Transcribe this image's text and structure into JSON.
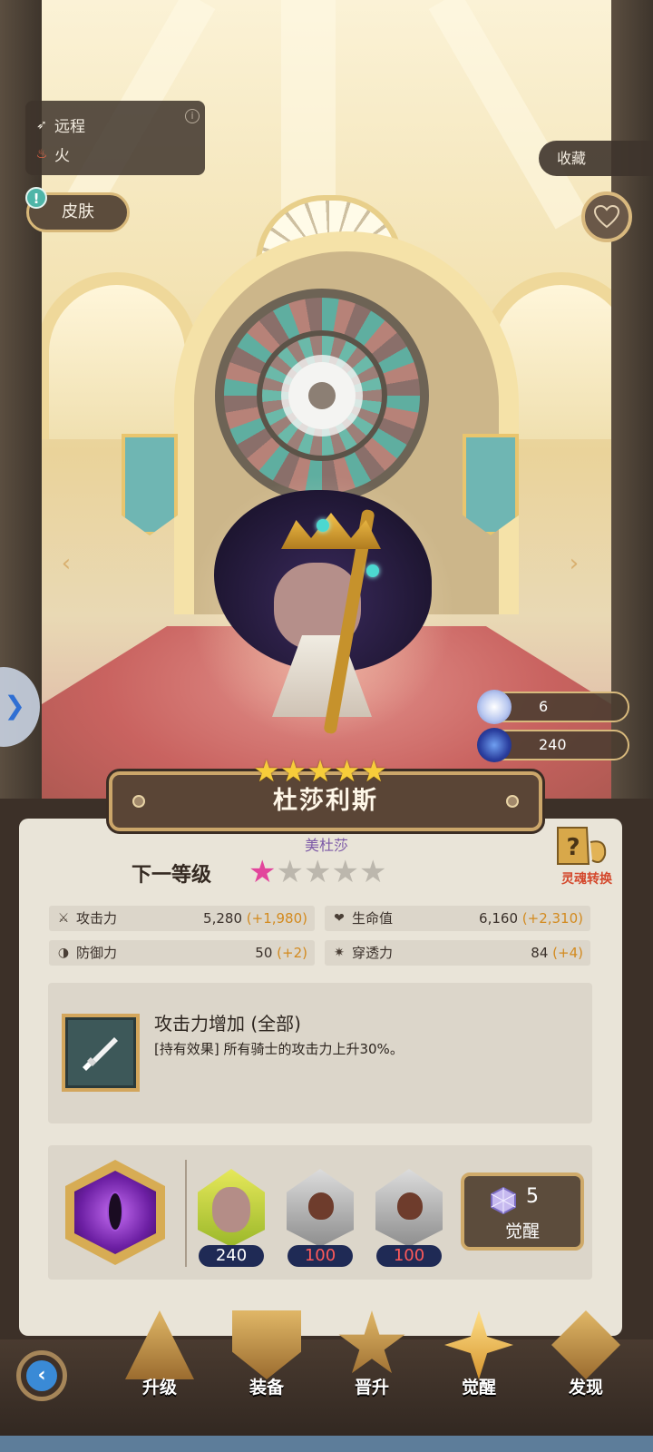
{
  "character": {
    "name": "杜莎利斯",
    "alias": "美杜莎",
    "attack_type": "远程",
    "element": "火",
    "star_count": 5
  },
  "top": {
    "skin_label": "皮肤",
    "collection_label": "收藏"
  },
  "resources": [
    {
      "icon": "crystal-gem-icon",
      "value": "6"
    },
    {
      "icon": "blue-gem-icon",
      "value": "240"
    }
  ],
  "next_level": {
    "label": "下一等级",
    "stars_total": 5,
    "stars_filled": 1
  },
  "soul_convert_label": "灵魂转换",
  "stats": [
    {
      "icon": "sword-icon",
      "label": "攻击力",
      "value": "5,280",
      "bonus": "(+1,980)"
    },
    {
      "icon": "heart-icon",
      "label": "生命值",
      "value": "6,160",
      "bonus": "(+2,310)"
    },
    {
      "icon": "shield-icon",
      "label": "防御力",
      "value": "50",
      "bonus": "(+2)"
    },
    {
      "icon": "pierce-icon",
      "label": "穿透力",
      "value": "84",
      "bonus": "(+4)"
    }
  ],
  "skill": {
    "title": "攻击力增加 (全部)",
    "description": "[持有效果] 所有骑士的攻击力上升30%。"
  },
  "awaken": {
    "materials": [
      {
        "type": "character-shard",
        "count": "240",
        "enough": true
      },
      {
        "type": "fire-stone",
        "count": "100",
        "enough": false
      },
      {
        "type": "fire-stone",
        "count": "100",
        "enough": false
      }
    ],
    "cost": "5",
    "button_label": "觉醒"
  },
  "bottom_nav": [
    {
      "label": "升级",
      "active": false
    },
    {
      "label": "装备",
      "active": false
    },
    {
      "label": "晋升",
      "active": false
    },
    {
      "label": "觉醒",
      "active": true
    },
    {
      "label": "发现",
      "active": false
    }
  ]
}
